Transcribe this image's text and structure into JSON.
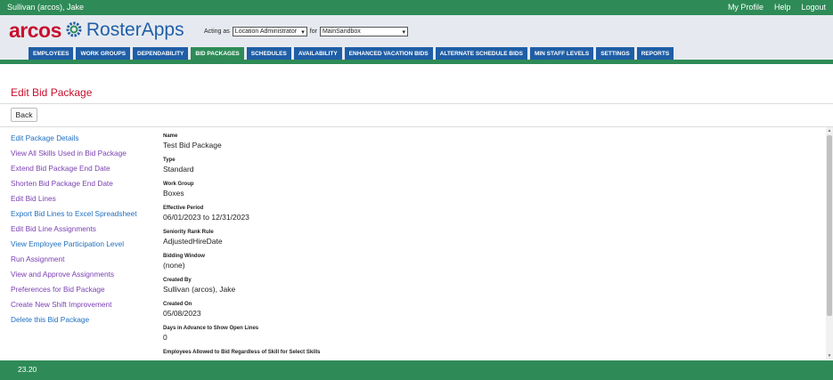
{
  "topbar": {
    "user": "Sullivan (arcos), Jake",
    "links": [
      "My Profile",
      "Help",
      "Logout"
    ]
  },
  "logo": {
    "brand": "arcos",
    "product": "RosterApps"
  },
  "acting": {
    "prefix": "Acting as",
    "role": "Location Administrator",
    "for_label": "for",
    "location": "MainSandbox"
  },
  "nav": [
    "EMPLOYEES",
    "WORK GROUPS",
    "DEPENDABILITY",
    "BID PACKAGES",
    "SCHEDULES",
    "AVAILABILITY",
    "ENHANCED VACATION BIDS",
    "ALTERNATE SCHEDULE BIDS",
    "MIN STAFF LEVELS",
    "SETTINGS",
    "REPORTS"
  ],
  "active_nav": "BID PACKAGES",
  "page": {
    "title": "Edit Bid Package",
    "back_label": "Back"
  },
  "sidebar": [
    "Edit Package Details",
    "View All Skills Used in Bid Package",
    "Extend Bid Package End Date",
    "Shorten Bid Package End Date",
    "Edit Bid Lines",
    "Export Bid Lines to Excel Spreadsheet",
    "Edit Bid Line Assignments",
    "View Employee Participation Level",
    "Run Assignment",
    "View and Approve Assignments",
    "Preferences for Bid Package",
    "Create New Shift Improvement",
    "Delete this Bid Package"
  ],
  "fields": [
    {
      "label": "Name",
      "value": "Test Bid Package"
    },
    {
      "label": "Type",
      "value": "Standard"
    },
    {
      "label": "Work Group",
      "value": "Boxes"
    },
    {
      "label": "Effective Period",
      "value": "06/01/2023 to 12/31/2023"
    },
    {
      "label": "Seniority Rank Rule",
      "value": "AdjustedHireDate"
    },
    {
      "label": "Bidding Window",
      "value": "(none)"
    },
    {
      "label": "Created By",
      "value": "Sullivan (arcos), Jake"
    },
    {
      "label": "Created On",
      "value": "05/08/2023"
    },
    {
      "label": "Days in Advance to Show Open Lines",
      "value": "0"
    },
    {
      "label": "Employees Allowed to Bid Regardless of Skill for Select Skills",
      "value": ""
    }
  ],
  "footer": {
    "version": "23.20"
  },
  "colors": {
    "green": "#2e8b57",
    "blue": "#1f5ea6",
    "red": "#c8102e",
    "link": "#1f6fbf",
    "visited": "#7a3fb2"
  }
}
